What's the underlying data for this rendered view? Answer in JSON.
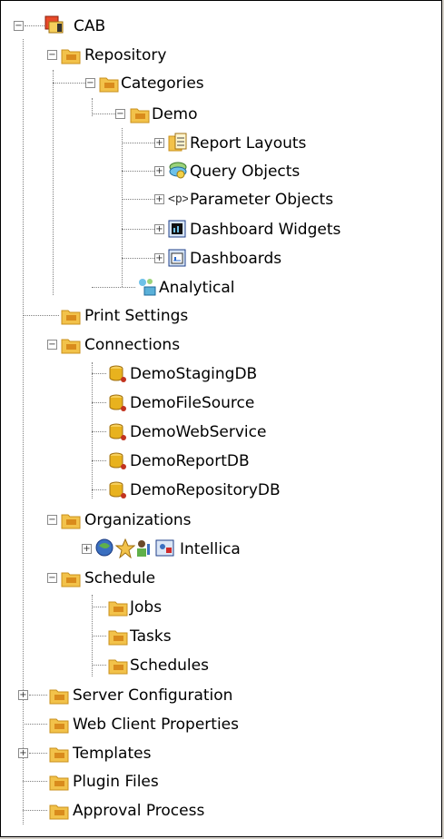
{
  "tree": {
    "root": "CAB",
    "repository": "Repository",
    "categories": "Categories",
    "demo": "Demo",
    "report_layouts": "Report Layouts",
    "query_objects": "Query Objects",
    "parameter_objects": "Parameter Objects",
    "dashboard_widgets": "Dashboard Widgets",
    "dashboards": "Dashboards",
    "analytical": "Analytical",
    "print_settings": "Print Settings",
    "connections": "Connections",
    "conn_items": [
      "DemoStagingDB",
      "DemoFileSource",
      "DemoWebService",
      "DemoReportDB",
      "DemoRepositoryDB"
    ],
    "organizations": "Organizations",
    "intellica": "Intellica",
    "schedule": "Schedule",
    "schedule_items": [
      "Jobs",
      "Tasks",
      "Schedules"
    ],
    "server_configuration": "Server Configuration",
    "web_client_properties": "Web Client Properties",
    "templates": "Templates",
    "plugin_files": "Plugin Files",
    "approval_process": "Approval Process"
  },
  "colors": {
    "folder": "#f2c24a",
    "folder_dark": "#c9901c",
    "database": "#e8b21e",
    "tree_line": "#808080"
  }
}
